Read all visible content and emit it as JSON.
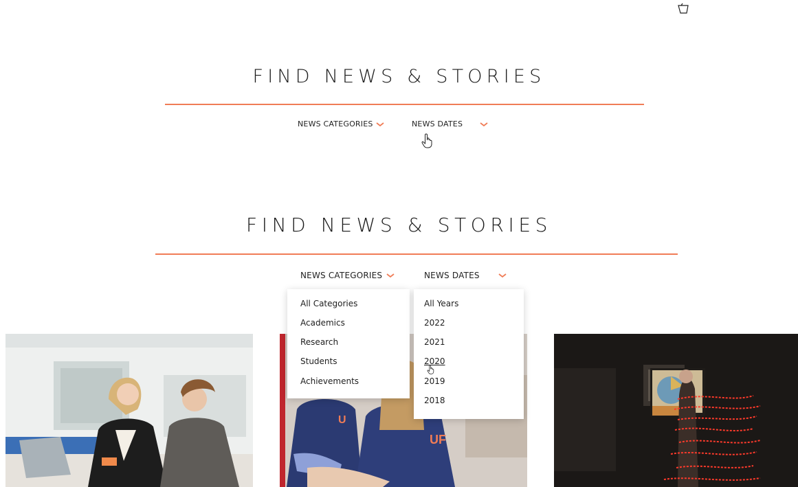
{
  "section_top": {
    "title": "FIND NEWS & STORIES",
    "filters": {
      "categories_label": "NEWS CATEGORIES",
      "dates_label": "NEWS DATES"
    }
  },
  "section_bottom": {
    "title": "FIND NEWS & STORIES",
    "filters": {
      "categories_label": "NEWS CATEGORIES",
      "dates_label": "NEWS DATES"
    },
    "categories_dropdown": {
      "items": [
        "All Categories",
        "Academics",
        "Research",
        "Students",
        "Achievements"
      ]
    },
    "dates_dropdown": {
      "items": [
        "All Years",
        "2022",
        "2021",
        "2020",
        "2019",
        "2018"
      ],
      "hovered": "2020"
    }
  },
  "photos": [
    {
      "icon": "photo-students-laptop"
    },
    {
      "icon": "photo-nursing-students"
    },
    {
      "icon": "photo-light-painting"
    }
  ],
  "icons": {
    "chevron": "chevron-down-icon",
    "cursor_top": "cursor-icon",
    "cursor_hand": "hand-cursor-icon"
  },
  "colors": {
    "accent": "#f07c56",
    "text": "#1e1e1e"
  }
}
